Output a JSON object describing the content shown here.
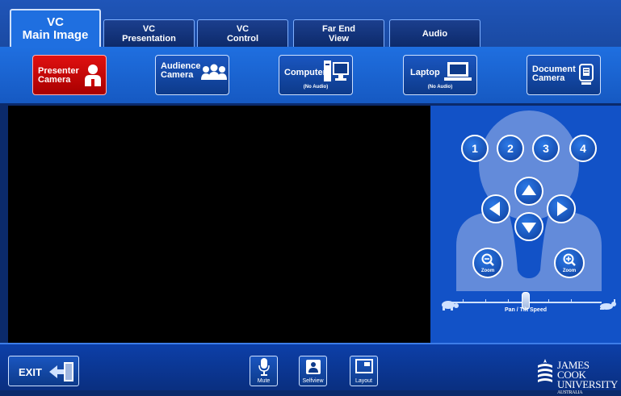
{
  "tabs": [
    {
      "line1": "VC",
      "line2": "Main Image",
      "active": true
    },
    {
      "line1": "VC",
      "line2": "Presentation",
      "active": false
    },
    {
      "line1": "VC",
      "line2": "Control",
      "active": false
    },
    {
      "line1": "Far End",
      "line2": "View",
      "active": false
    },
    {
      "line1": "Audio",
      "line2": "",
      "active": false
    }
  ],
  "sources": [
    {
      "line1": "Presenter",
      "line2": "Camera",
      "sub": "",
      "icon": "presenter-icon",
      "active": true
    },
    {
      "line1": "Audience",
      "line2": "Camera",
      "sub": "",
      "icon": "audience-icon",
      "active": false
    },
    {
      "line1": "Computer",
      "line2": "",
      "sub": "(No Audio)",
      "icon": "computer-icon",
      "active": false
    },
    {
      "line1": "Laptop",
      "line2": "",
      "sub": "(No Audio)",
      "icon": "laptop-icon",
      "active": false
    },
    {
      "line1": "Document",
      "line2": "Camera",
      "sub": "",
      "icon": "document-camera-icon",
      "active": false
    }
  ],
  "presets": [
    "1",
    "2",
    "3",
    "4"
  ],
  "zoom": {
    "out_label": "Zoom",
    "in_label": "Zoom"
  },
  "speed": {
    "label": "Pan / Tilt Speed",
    "value": 0.5
  },
  "bottom": {
    "exit_label": "EXIT",
    "mute_label": "Mute",
    "selfview_label": "Selfview",
    "layout_label": "Layout"
  },
  "logo": {
    "line1": "JAMES COOK",
    "line2": "UNIVERSITY",
    "line3": "AUSTRALIA"
  },
  "colors": {
    "accent": "#1f6fe0",
    "active_source": "#e01010",
    "panel": "#1252c7"
  }
}
